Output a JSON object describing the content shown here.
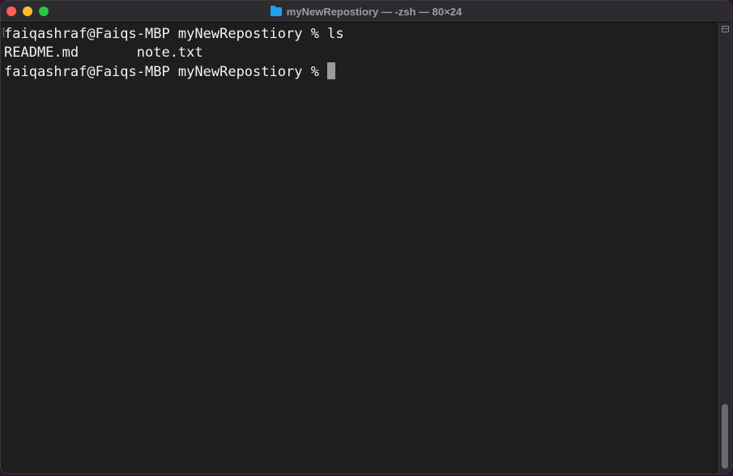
{
  "window": {
    "title": "myNewRepostiory — -zsh — 80×24",
    "folder_icon": "folder-icon"
  },
  "terminal": {
    "lines": [
      {
        "prompt": "faiqashraf@Faiqs-MBP myNewRepostiory % ",
        "command": "ls"
      },
      {
        "output": "README.md       note.txt"
      },
      {
        "prompt": "faiqashraf@Faiqs-MBP myNewRepostiory % ",
        "command": ""
      }
    ]
  },
  "colors": {
    "background": "#1e1e1e",
    "text": "#f2f2f2",
    "cursor": "#9b9b9b"
  }
}
